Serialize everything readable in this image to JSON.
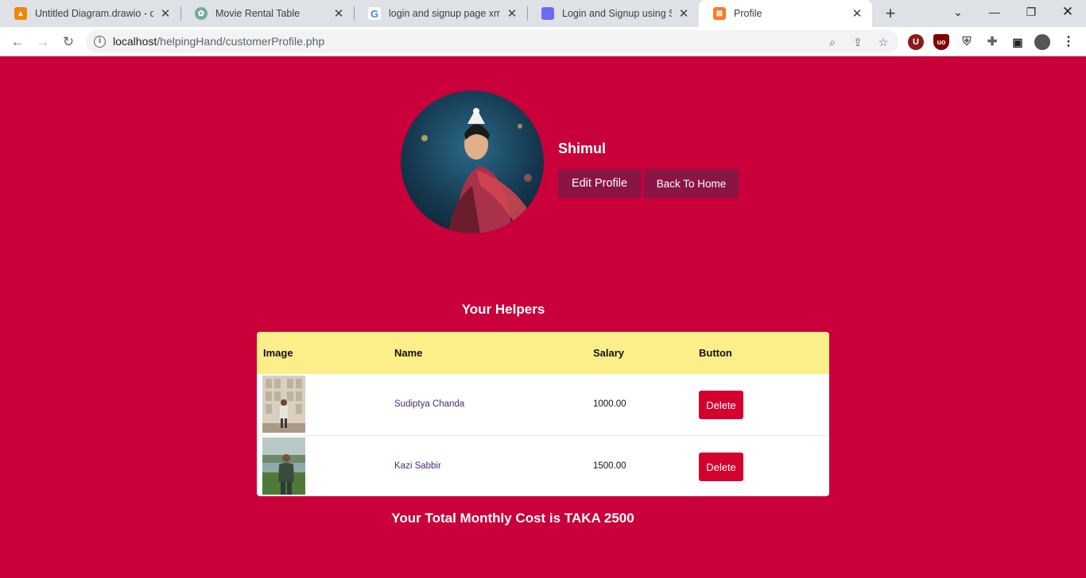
{
  "browser": {
    "tabs": [
      {
        "title": "Untitled Diagram.drawio - dr",
        "icon": "drawio-icon",
        "color": "#f08705"
      },
      {
        "title": "Movie Rental Table",
        "icon": "chatgpt-icon",
        "color": "#74aa9c"
      },
      {
        "title": "login and signup page xml ar",
        "icon": "google-icon",
        "color": "#4285f4"
      },
      {
        "title": "Login and Signup using SQLi",
        "icon": "site-icon",
        "color": "#6a6cf6"
      },
      {
        "title": "Profile",
        "icon": "xampp-icon",
        "color": "#fb7a24"
      }
    ],
    "address": {
      "host": "localhost",
      "path": "/helpingHand/customerProfile.php"
    }
  },
  "profile": {
    "name": "Shimul",
    "edit_label": "Edit Profile",
    "home_label": "Back To Home"
  },
  "helpers": {
    "title": "Your Helpers",
    "columns": [
      "Image",
      "Name",
      "Salary",
      "Button"
    ],
    "rows": [
      {
        "name": "Sudiptya Chanda",
        "salary": "1000.00",
        "action": "Delete"
      },
      {
        "name": "Kazi Sabbir",
        "salary": "1500.00",
        "action": "Delete"
      }
    ]
  },
  "total_text": "Your Total Monthly Cost is TAKA 2500"
}
